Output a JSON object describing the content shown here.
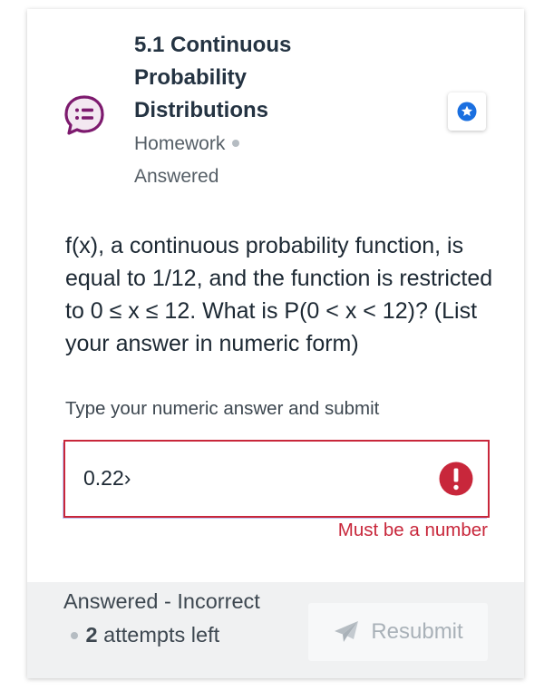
{
  "assignment": {
    "title": "5.1 Continuous Probability Distributions",
    "type": "Homework",
    "status": "Answered",
    "icon": "chat-bubble-list-icon",
    "bookmark_icon": "star-icon"
  },
  "question": {
    "text": "f(x), a continuous probability function, is equal to 1/12, and the function is restricted to 0 ≤ x ≤ 12. What is P(0 < x < 12)? (List your answer in numeric form)"
  },
  "answer": {
    "label": "Type your numeric answer and submit",
    "value": "0.22›",
    "error_message": "Must be a number",
    "error_icon": "exclamation-icon"
  },
  "footer": {
    "status_prefix": "Answered - Incorrect",
    "attempts_count": "2",
    "attempts_suffix": "attempts left",
    "resubmit_label": "Resubmit",
    "resubmit_icon": "paper-plane-icon"
  },
  "colors": {
    "title": "#243342",
    "error": "#c8273b",
    "icon_purple": "#7d1a6e",
    "star_blue": "#1a6fe0",
    "footer_bg": "#f0f1f2",
    "disabled_text": "#a9b1b8"
  }
}
